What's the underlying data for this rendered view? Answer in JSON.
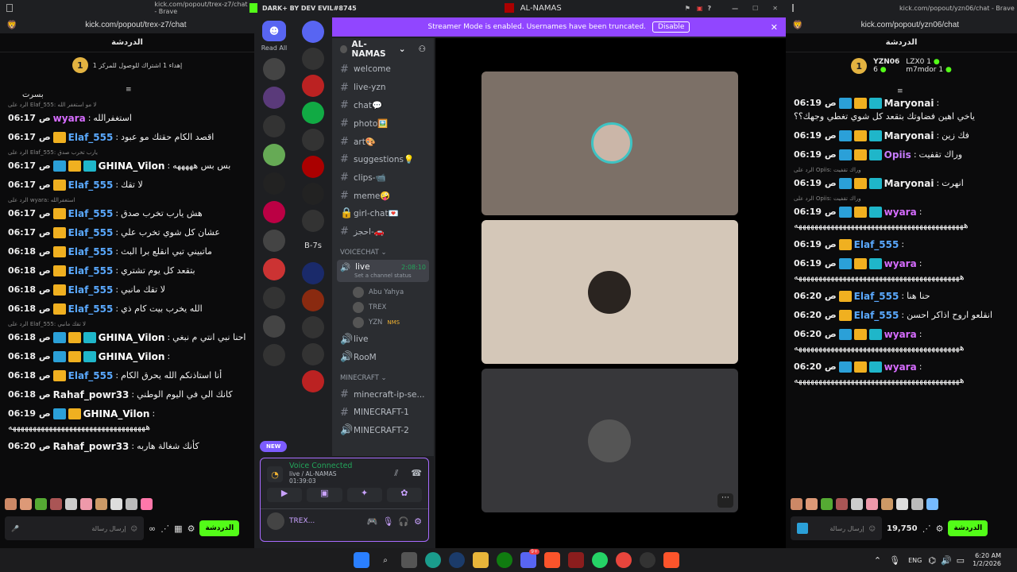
{
  "left_window": {
    "title": "kick.com/popout/trex-z7/chat - Brave",
    "url": "kick.com/popout/trex-z7/chat",
    "chat_header": "الدردشة",
    "pinned_badge": "1",
    "pinned_text": "إهداء 1 اشتراك للوصول للمركز 1",
    "top_fragment": "بسرت",
    "messages": [
      {
        "reply": "الرد على Elaf_555: لا مو استغفر الله",
        "time": "06:17 ص",
        "user": "wyara",
        "color": "#d66cff",
        "badges": [],
        "text": "استغفرالله"
      },
      {
        "reply": "",
        "time": "06:17 ص",
        "user": "Elaf_555",
        "color": "#5aa9ff",
        "badges": [
          "crown"
        ],
        "text": "اقصد الكام حقتك مو عبود"
      },
      {
        "reply": "الرد على Elaf_555: يارب تخرب صدق",
        "time": "06:17 ص",
        "user": "GHINA_Vilon",
        "color": "#ffffff",
        "badges": [
          "tool",
          "crown",
          "vip"
        ],
        "text": "بس بس هههههه"
      },
      {
        "reply": "",
        "time": "06:17 ص",
        "user": "Elaf_555",
        "color": "#5aa9ff",
        "badges": [
          "crown"
        ],
        "text": "لا تقك"
      },
      {
        "reply": "الرد على wyara: استغفرالله",
        "time": "06:17 ص",
        "user": "Elaf_555",
        "color": "#5aa9ff",
        "badges": [
          "crown"
        ],
        "text": "هش يارب تخرب صدق"
      },
      {
        "reply": "",
        "time": "06:17 ص",
        "user": "Elaf_555",
        "color": "#5aa9ff",
        "badges": [
          "crown"
        ],
        "text": "عشان كل شوي تخرب علي"
      },
      {
        "reply": "",
        "time": "06:18 ص",
        "user": "Elaf_555",
        "color": "#5aa9ff",
        "badges": [
          "crown"
        ],
        "text": "ماتبيني تبي انقلع برا البث"
      },
      {
        "reply": "",
        "time": "06:18 ص",
        "user": "Elaf_555",
        "color": "#5aa9ff",
        "badges": [
          "crown"
        ],
        "text": "بتقعد كل يوم تشتري"
      },
      {
        "reply": "",
        "time": "06:18 ص",
        "user": "Elaf_555",
        "color": "#5aa9ff",
        "badges": [
          "crown"
        ],
        "text": "لا تقك مانبي"
      },
      {
        "reply": "",
        "time": "06:18 ص",
        "user": "Elaf_555",
        "color": "#5aa9ff",
        "badges": [
          "crown"
        ],
        "text": "الله يخرب بيت كام ذي"
      },
      {
        "reply": "الرد على Elaf_555: لا تقك مانبي",
        "time": "06:18 ص",
        "user": "GHINA_Vilon",
        "color": "#ffffff",
        "badges": [
          "tool",
          "crown",
          "vip"
        ],
        "text": "احنا نبي انتي م نبغي"
      },
      {
        "reply": "",
        "time": "06:18 ص",
        "user": "GHINA_Vilon",
        "color": "#ffffff",
        "badges": [
          "tool",
          "crown",
          "vip"
        ],
        "text": ""
      },
      {
        "reply": "",
        "time": "06:18 ص",
        "user": "Elaf_555",
        "color": "#5aa9ff",
        "badges": [
          "crown"
        ],
        "text": "أنا استاذنكم الله يحرق الكام"
      },
      {
        "reply": "",
        "time": "06:18 ص",
        "user": "Rahaf_powr33",
        "color": "#f0f0f0",
        "badges": [],
        "text": "كانك الي في اليوم الوطني"
      },
      {
        "reply": "",
        "time": "06:19 ص",
        "user": "GHINA_Vilon",
        "color": "#ffffff",
        "badges": [
          "tool",
          "crown"
        ],
        "text": "ههههههههههههههههههههههههههههههههههه"
      },
      {
        "reply": "",
        "time": "06:20 ص",
        "user": "Rahaf_powr33",
        "color": "#f0f0f0",
        "badges": [],
        "text": "كأنك شغالة هاربه"
      }
    ],
    "input_placeholder": "إرسال رسالة",
    "send_label": "الدردشة"
  },
  "right_window": {
    "title": "kick.com/popout/yzn06/chat - Brave",
    "url": "kick.com/popout/yzn06/chat",
    "chat_header": "الدردشة",
    "leaders": [
      {
        "name": "YZN06",
        "count": "1"
      },
      {
        "name": "LZX0",
        "count": "1"
      },
      {
        "name": "6",
        "count": ""
      },
      {
        "name": "m7mdor",
        "count": "1"
      }
    ],
    "messages": [
      {
        "reply": "",
        "time": "06:19 ص",
        "user": "Maryonai",
        "color": "#f0f0f0",
        "badges": [
          "tool",
          "crown",
          "vip"
        ],
        "text": "ياخي اهين فضاوتك بتقعد كل شوي تغطي وجهك؟؟"
      },
      {
        "reply": "",
        "time": "06:19 ص",
        "user": "Maryonai",
        "color": "#f0f0f0",
        "badges": [
          "tool",
          "crown",
          "vip"
        ],
        "text": "فك زين"
      },
      {
        "reply": "",
        "time": "06:19 ص",
        "user": "Opiis",
        "color": "#c77dff",
        "badges": [
          "tool",
          "crown",
          "vip"
        ],
        "text": "وراك تقفيت"
      },
      {
        "reply": "الرد على Opiis: وراك تقفيت",
        "time": "06:19 ص",
        "user": "Maryonai",
        "color": "#f0f0f0",
        "badges": [
          "tool",
          "crown",
          "vip"
        ],
        "text": "انهرت"
      },
      {
        "reply": "الرد على Opiis: وراك تقفيت",
        "time": "06:19 ص",
        "user": "wyara",
        "color": "#d66cff",
        "badges": [
          "tool",
          "crown",
          "vip"
        ],
        "text": "ههههههههههههههههههههههههههههههههههههههههههه"
      },
      {
        "reply": "",
        "time": "06:19 ص",
        "user": "Elaf_555",
        "color": "#5aa9ff",
        "badges": [
          "crown"
        ],
        "text": ""
      },
      {
        "reply": "",
        "time": "06:19 ص",
        "user": "wyara",
        "color": "#d66cff",
        "badges": [
          "tool",
          "crown",
          "vip"
        ],
        "text": "هههههههههههههههههههههههههههههههههههههههههه"
      },
      {
        "reply": "",
        "time": "06:20 ص",
        "user": "Elaf_555",
        "color": "#5aa9ff",
        "badges": [
          "crown"
        ],
        "text": "حنا هنا"
      },
      {
        "reply": "",
        "time": "06:20 ص",
        "user": "Elaf_555",
        "color": "#5aa9ff",
        "badges": [
          "crown"
        ],
        "text": "انقلعو اروح اذاكر احسن"
      },
      {
        "reply": "",
        "time": "06:20 ص",
        "user": "wyara",
        "color": "#d66cff",
        "badges": [
          "tool",
          "crown",
          "vip"
        ],
        "text": "هههههههههههههههههههههههههههههههههههههههههه"
      },
      {
        "reply": "",
        "time": "06:20 ص",
        "user": "wyara",
        "color": "#d66cff",
        "badges": [
          "tool",
          "crown",
          "vip"
        ],
        "text": "هههههههههههههههههههههههههههههههههههههههههه"
      }
    ],
    "input_placeholder": "إرسال رسالة",
    "points": "19,750",
    "send_label": "الدردشة"
  },
  "discord": {
    "window_title": "AL-NAMAS",
    "brand": "DARK+ BY DEV EVIL#8745",
    "read_all": "Read All",
    "server_name": "AL-NAMAS",
    "banner_text": "Streamer Mode is enabled. Usernames have been truncated.",
    "banner_btn": "Disable",
    "new_label": "NEW",
    "server_label": "B-7s",
    "channels_top": [
      {
        "type": "text",
        "name": "welcome"
      },
      {
        "type": "text",
        "name": "live-yzn"
      },
      {
        "type": "text",
        "name": "chat💬"
      },
      {
        "type": "text",
        "name": "photo🖼️"
      },
      {
        "type": "text",
        "name": "art🎨"
      },
      {
        "type": "text",
        "name": "suggestions💡"
      },
      {
        "type": "text",
        "name": "clips-📹"
      },
      {
        "type": "text",
        "name": "meme🤪"
      },
      {
        "type": "lock",
        "name": "girl-chat💌"
      },
      {
        "type": "text",
        "name": "احجز-🚗"
      }
    ],
    "voice_category": "VOICECHAT",
    "live_channel": "live",
    "live_timer": "2:08:10",
    "live_status": "Set a channel status",
    "voice_users": [
      {
        "name": "Abu Yahya",
        "tag": ""
      },
      {
        "name": "TREX",
        "tag": ""
      },
      {
        "name": "YZN",
        "tag": "NMS"
      }
    ],
    "voice_channels": [
      "live",
      "RooM"
    ],
    "minecraft_category": "MINECRAFT",
    "minecraft_channels": [
      {
        "type": "text",
        "name": "minecraft-ip-se..."
      },
      {
        "type": "text",
        "name": "MINECRAFT-1"
      },
      {
        "type": "voice",
        "name": "MINECRAFT-2"
      }
    ],
    "voice_connected": "Voice Connected",
    "voice_location": "live / AL-NAMAS",
    "voice_timer": "01:39:03",
    "user_name": "TREX..."
  },
  "taskbar": {
    "lang": "ENG",
    "time": "6:20 AM",
    "date": "1/2/2026",
    "notif_badge": "9+"
  },
  "colors": {
    "kick_green": "#53fc18",
    "discord_purple": "#9146ff",
    "crown": "#f0b020"
  }
}
